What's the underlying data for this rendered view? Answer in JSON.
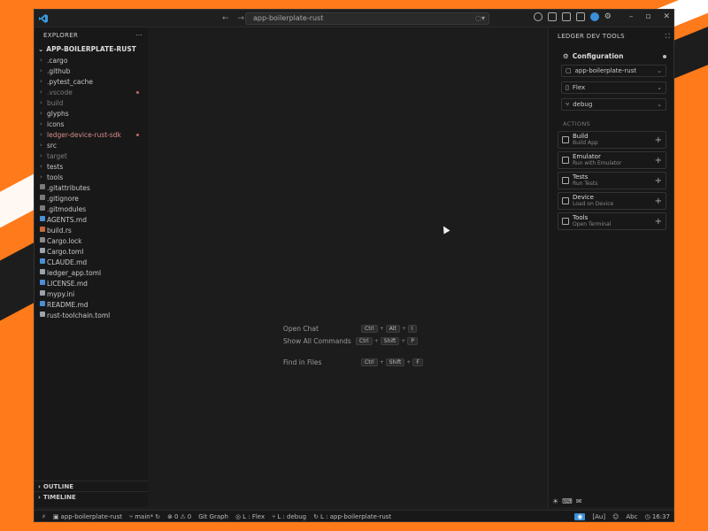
{
  "titlebar": {
    "search_text": "app-boilerplate-rust",
    "back_glyph": "←",
    "forward_glyph": "→"
  },
  "explorer": {
    "header": "EXPLORER",
    "more": "···",
    "project": "APP-BOILERPLATE-RUST",
    "items": [
      {
        "label": ".cargo",
        "type": "folder",
        "state": "normal"
      },
      {
        "label": ".github",
        "type": "folder",
        "state": "normal"
      },
      {
        "label": ".pytest_cache",
        "type": "folder",
        "state": "normal"
      },
      {
        "label": ".vscode",
        "type": "folder",
        "state": "ignored"
      },
      {
        "label": "build",
        "type": "folder",
        "state": "ignored"
      },
      {
        "label": "glyphs",
        "type": "folder",
        "state": "normal"
      },
      {
        "label": "icons",
        "type": "folder",
        "state": "normal"
      },
      {
        "label": "ledger-device-rust-sdk",
        "type": "folder",
        "state": "modified"
      },
      {
        "label": "src",
        "type": "folder",
        "state": "normal"
      },
      {
        "label": "target",
        "type": "folder",
        "state": "ignored"
      },
      {
        "label": "tests",
        "type": "folder",
        "state": "normal"
      },
      {
        "label": "tools",
        "type": "folder",
        "state": "normal"
      },
      {
        "label": ".gitattributes",
        "type": "file",
        "state": "normal"
      },
      {
        "label": ".gitignore",
        "type": "file",
        "state": "normal"
      },
      {
        "label": ".gitmodules",
        "type": "file",
        "state": "normal"
      },
      {
        "label": "AGENTS.md",
        "type": "file",
        "state": "normal"
      },
      {
        "label": "build.rs",
        "type": "file",
        "state": "normal"
      },
      {
        "label": "Cargo.lock",
        "type": "file",
        "state": "normal"
      },
      {
        "label": "Cargo.toml",
        "type": "file",
        "state": "normal"
      },
      {
        "label": "CLAUDE.md",
        "type": "file",
        "state": "normal"
      },
      {
        "label": "ledger_app.toml",
        "type": "file",
        "state": "normal"
      },
      {
        "label": "LICENSE.md",
        "type": "file",
        "state": "normal"
      },
      {
        "label": "mypy.ini",
        "type": "file",
        "state": "normal"
      },
      {
        "label": "README.md",
        "type": "file",
        "state": "normal"
      },
      {
        "label": "rust-toolchain.toml",
        "type": "file",
        "state": "normal"
      }
    ],
    "outline": "OUTLINE",
    "timeline": "TIMELINE"
  },
  "editor_hints": [
    {
      "label": "Open Chat",
      "keys": [
        "Ctrl",
        "Alt",
        "I"
      ]
    },
    {
      "label": "Show All Commands",
      "keys": [
        "Ctrl",
        "Shift",
        "P"
      ]
    },
    {
      "label": "Find in Files",
      "keys": [
        "Ctrl",
        "Shift",
        "F"
      ]
    }
  ],
  "panel": {
    "header": "LEDGER DEV TOOLS",
    "config_title": "Configuration",
    "selects": [
      {
        "value": "app-boilerplate-rust",
        "icon": "folder-icon"
      },
      {
        "value": "Flex",
        "icon": "device-icon"
      },
      {
        "value": "debug",
        "icon": "branch-icon"
      }
    ],
    "actions_label": "ACTIONS",
    "actions": [
      {
        "title": "Build",
        "subtitle": "Build App"
      },
      {
        "title": "Emulator",
        "subtitle": "Run with Emulator"
      },
      {
        "title": "Tests",
        "subtitle": "Run Tests"
      },
      {
        "title": "Device",
        "subtitle": "Load on Device"
      },
      {
        "title": "Tools",
        "subtitle": "Open Terminal"
      }
    ]
  },
  "statusbar": {
    "workspace": "app-boilerplate-rust",
    "branch": "main*",
    "errors": "0",
    "warnings": "0",
    "git_graph": "Git Graph",
    "device": "L : Flex",
    "profile": "L : debug",
    "app": "L : app-boilerplate-rust",
    "lang_badge": "[Au]",
    "abc": "Abc",
    "time": "16:37"
  },
  "colors": {
    "accent": "#3a8fd8",
    "modified": "#d98c8c",
    "desktop": "#ff7a1a"
  }
}
